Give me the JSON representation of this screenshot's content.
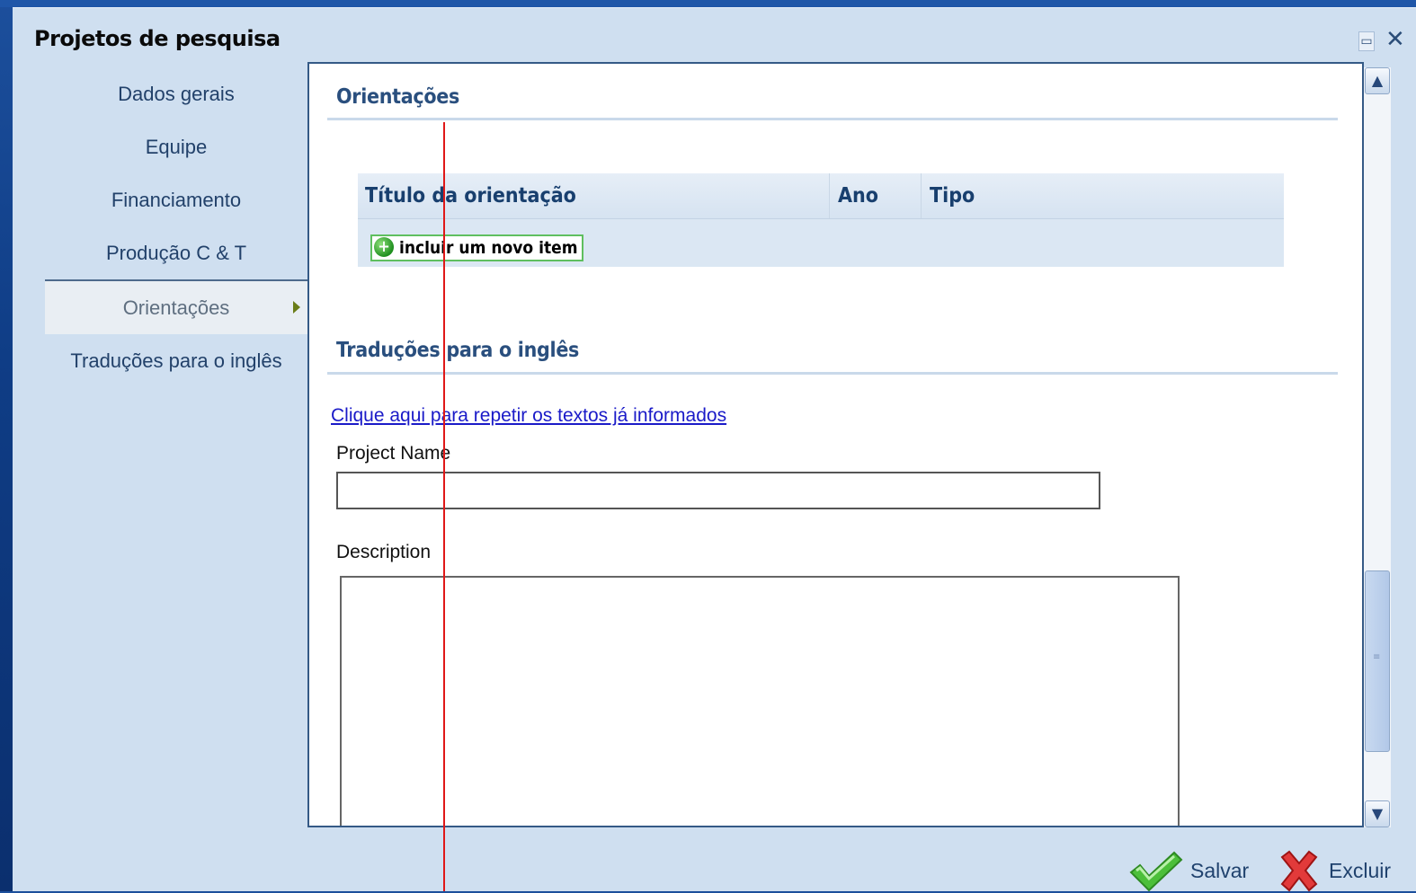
{
  "window": {
    "title": "Projetos de pesquisa",
    "controls": [
      "restore-icon",
      "close-icon"
    ]
  },
  "nav": {
    "items": [
      {
        "label": "Dados gerais",
        "active": false
      },
      {
        "label": "Equipe",
        "active": false
      },
      {
        "label": "Financiamento",
        "active": false
      },
      {
        "label": "Produção C & T",
        "active": false
      },
      {
        "label": "Orientações",
        "active": true
      },
      {
        "label": "Traduções para o inglês",
        "active": false
      }
    ]
  },
  "orientacoes": {
    "title": "Orientações",
    "columns": [
      "Título da orientação",
      "Ano",
      "Tipo"
    ],
    "add_button": "incluir um novo item"
  },
  "traducoes": {
    "title": "Traduções para o inglês",
    "repeat_link": "Clique aqui para repetir os textos já informados",
    "project_name_label": "Project Name",
    "project_name_value": "",
    "description_label": "Description",
    "description_value": ""
  },
  "actions": {
    "save": "Salvar",
    "delete": "Excluir"
  },
  "colors": {
    "accent": "#2a4f7e",
    "link": "#1a1ac8",
    "annotation_line": "#e01818"
  }
}
